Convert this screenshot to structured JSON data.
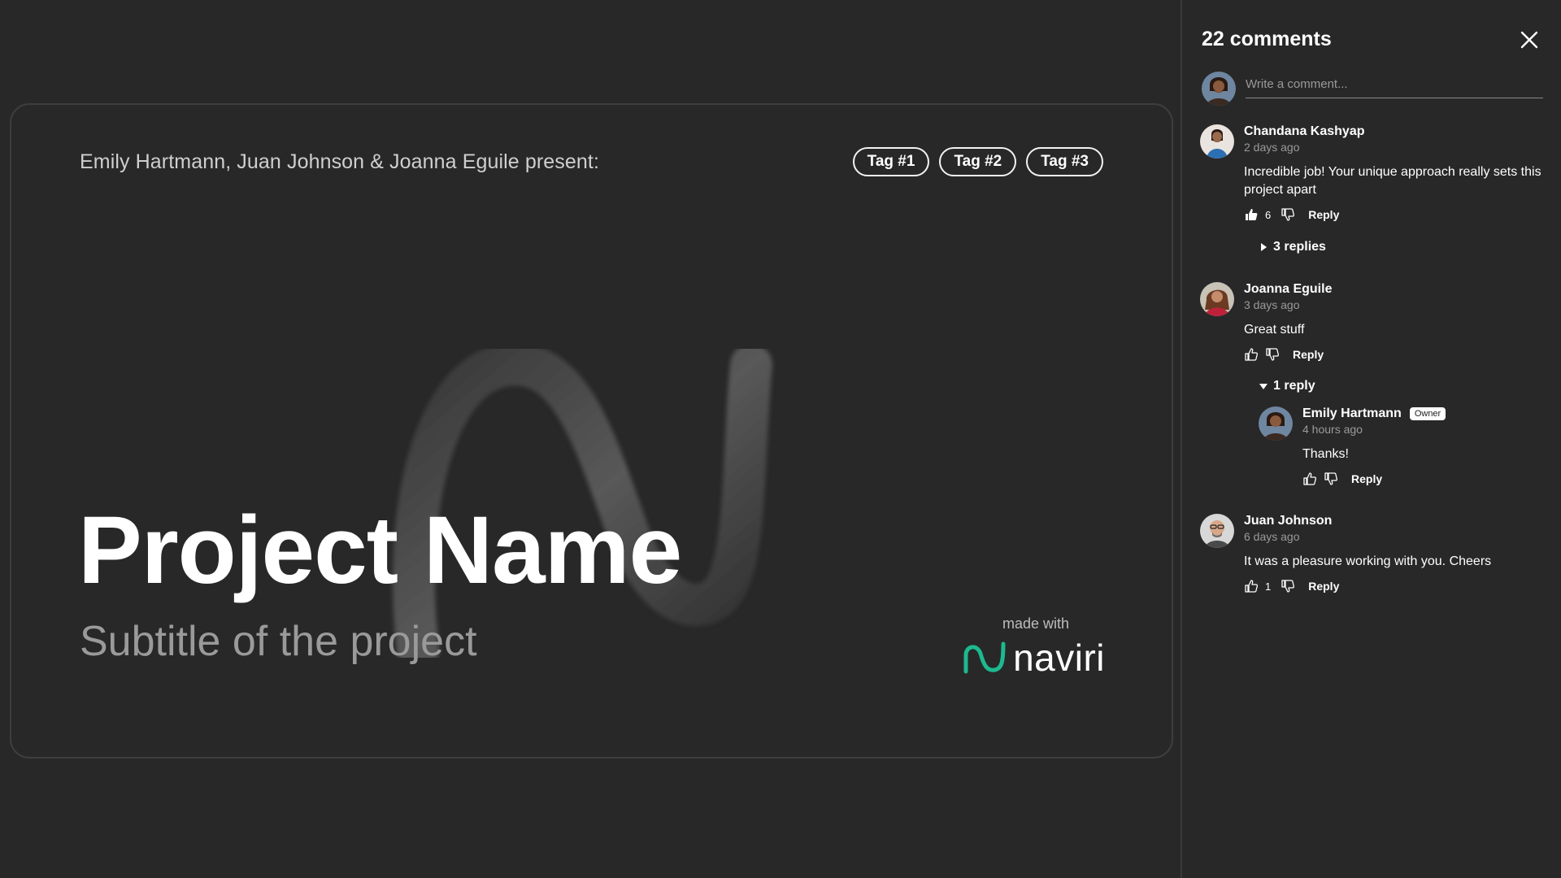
{
  "presentation": {
    "presenters": "Emily Hartmann, Juan Johnson & Joanna Eguile present:",
    "tags": [
      "Tag #1",
      "Tag #2",
      "Tag #3"
    ],
    "title": "Project Name",
    "subtitle": "Subtitle of the project",
    "made_with_label": "made with",
    "brand_name": "naviri",
    "brand_color": "#1db98f"
  },
  "comments_panel": {
    "title": "22 comments",
    "composer_placeholder": "Write a comment...",
    "comments": [
      {
        "author": "Chandana Kashyap",
        "time": "2 days ago",
        "text": "Incredible job! Your unique approach really sets this project apart",
        "likes": "6",
        "reply_label": "Reply",
        "thread_toggle": "3 replies"
      },
      {
        "author": "Joanna Eguile",
        "time": "3 days ago",
        "text": "Great stuff",
        "reply_label": "Reply",
        "thread_toggle": "1 reply",
        "replies": [
          {
            "author": "Emily Hartmann",
            "badge": "Owner",
            "time": "4 hours ago",
            "text": "Thanks!",
            "reply_label": "Reply"
          }
        ]
      },
      {
        "author": "Juan Johnson",
        "time": "6 days ago",
        "text": "It was a pleasure working with you. Cheers",
        "likes": "1",
        "reply_label": "Reply"
      }
    ]
  }
}
